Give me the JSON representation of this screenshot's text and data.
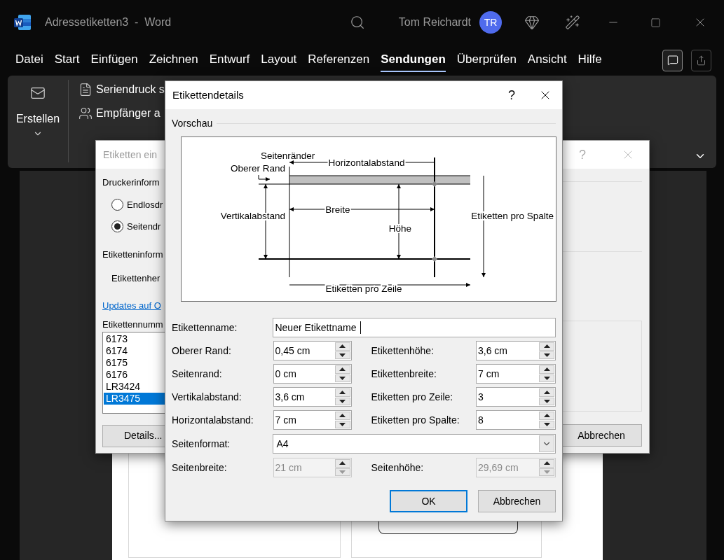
{
  "window": {
    "title": "Adressetiketten3  -  Word",
    "user": "Tom Reichardt",
    "avatar": "TR"
  },
  "ribbon_tabs": [
    {
      "label": "Datei",
      "selected": false
    },
    {
      "label": "Start",
      "selected": false
    },
    {
      "label": "Einfügen",
      "selected": false
    },
    {
      "label": "Zeichnen",
      "selected": false
    },
    {
      "label": "Entwurf",
      "selected": false
    },
    {
      "label": "Layout",
      "selected": false
    },
    {
      "label": "Referenzen",
      "selected": false
    },
    {
      "label": "Sendungen",
      "selected": true
    },
    {
      "label": "Überprüfen",
      "selected": false
    },
    {
      "label": "Ansicht",
      "selected": false
    },
    {
      "label": "Hilfe",
      "selected": false
    }
  ],
  "ribbon": {
    "create_button": "Erstellen",
    "commands": [
      {
        "label": "Seriendruck s"
      },
      {
        "label": "Empfänger a"
      }
    ]
  },
  "back_dialog": {
    "title": "Etiketten ein",
    "help": "?",
    "printer_heading": "Druckerinform",
    "printer_options": [
      {
        "label": "Endlosdr",
        "selected": false
      },
      {
        "label": "Seitendr",
        "selected": true
      }
    ],
    "label_heading": "Etiketteninform",
    "vendor_label": "Etikettenher",
    "link": "Updates auf O",
    "number_label": "Etikettennumm",
    "label_numbers": [
      {
        "label": "6173",
        "selected": false
      },
      {
        "label": "6174",
        "selected": false
      },
      {
        "label": "6175",
        "selected": false
      },
      {
        "label": "6176",
        "selected": false
      },
      {
        "label": "LR3424",
        "selected": false
      },
      {
        "label": "LR3475",
        "selected": true
      }
    ],
    "details_button": "Details...",
    "cancel_button": "Abbrechen"
  },
  "dialog": {
    "title": "Etikettendetails",
    "help": "?",
    "preview": {
      "heading": "Vorschau",
      "margins": "Seitenränder",
      "top_margin": "Oberer Rand",
      "horizontal_pitch": "Horizontalabstand",
      "vertical_pitch": "Vertikalabstand",
      "width": "Breite",
      "height": "Höhe",
      "labels_per_column": "Etiketten pro Spalte",
      "labels_per_row": "Etiketten pro Zeile"
    },
    "name_field": {
      "label": "Etikettenname:",
      "value": "Neuer Etikettname"
    },
    "fields": [
      {
        "label": "Oberer Rand:",
        "value": "0,45 cm",
        "disabled": false
      },
      {
        "label": "Etikettenhöhe:",
        "value": "3,6 cm",
        "disabled": false
      },
      {
        "label": "Seitenrand:",
        "value": "0 cm",
        "disabled": false
      },
      {
        "label": "Etikettenbreite:",
        "value": "7 cm",
        "disabled": false
      },
      {
        "label": "Vertikalabstand:",
        "value": "3,6 cm",
        "disabled": false
      },
      {
        "label": "Etiketten pro Zeile:",
        "value": "3",
        "disabled": false
      },
      {
        "label": "Horizontalabstand:",
        "value": "7 cm",
        "disabled": false
      },
      {
        "label": "Etiketten pro Spalte:",
        "value": "8",
        "disabled": false
      }
    ],
    "page_format": {
      "label": "Seitenformat:",
      "value": "A4"
    },
    "page_fields": [
      {
        "label": "Seitenbreite:",
        "value": "21 cm",
        "disabled": true
      },
      {
        "label": "Seitenhöhe:",
        "value": "29,69 cm",
        "disabled": true
      }
    ],
    "buttons": [
      {
        "label": "OK",
        "default": true
      },
      {
        "label": "Abbrechen",
        "default": false
      }
    ]
  }
}
